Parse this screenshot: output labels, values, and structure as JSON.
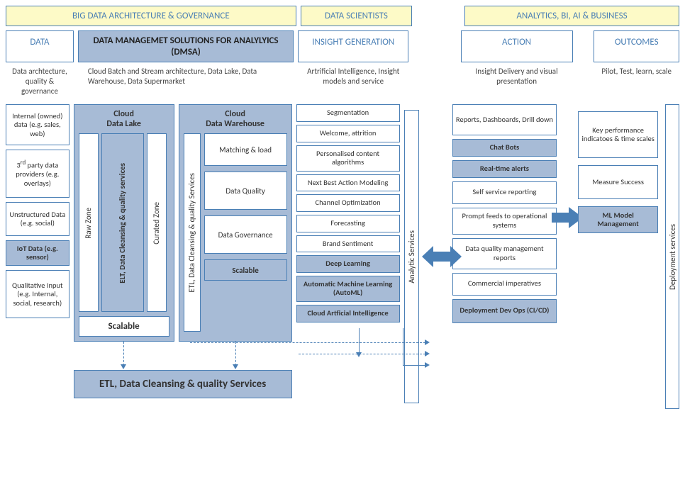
{
  "headers": {
    "h1": "BIG DATA ARCHITECTURE & GOVERNANCE",
    "h2": "DATA SCIENTISTS",
    "h3": "ANALYTICS, BI, AI & BUSINESS"
  },
  "stages": {
    "data": "DATA",
    "dmsa_l1": "DATA MANAGEMET SOLUTIONS FOR ANALYLYICS",
    "dmsa_l2": "(DMSA)",
    "insight": "INSIGHT GENERATION",
    "action": "ACTION",
    "outcomes": "OUTCOMES"
  },
  "subs": {
    "data": "Data archtecture, quality & governance",
    "dmsa": "Cloud Batch and Stream architecture, Data Lake, Data Warehouse, Data Supermarket",
    "insight": "Artrificial Intelligence, Insight models and service",
    "action": "Insight Delivery and visual presentation",
    "outcomes": "Pilot, Test, learn, scale"
  },
  "data_sources": {
    "s1": "Internal (owned) data (e.g. sales, web)",
    "s2_a": "3",
    "s2_b": "rd",
    "s2_c": " party data providers (e.g. overlays)",
    "s3": "Unstructured Data (e.g. social)",
    "s4": "IoT Data (e.g. sensor)",
    "s5": "Qualitative Input (e.g. Internal, social, research)"
  },
  "cloud_lake": {
    "title": "Cloud\nData Lake",
    "raw": "Raw Zone",
    "elt": "ELT, Data Cleansing & quality services",
    "curated": "Curated Zone",
    "scalable": "Scalable"
  },
  "cloud_dw": {
    "title": "Cloud\nData Warehouse",
    "etl": "ETL, Data Cleansing & quality Services",
    "b1": "Matching & load",
    "b2": "Data Quality",
    "b3": "Data Governance",
    "b4": "Scalable"
  },
  "etl_bar": "ETL, Data Cleansing & quality Services",
  "insight_items": {
    "i1": "Segmentation",
    "i2": "Welcome, attrition",
    "i3": "Personalised content algorithms",
    "i4": "Next Best Action Modeling",
    "i5": "Channel Optimization",
    "i6": "Forecasting",
    "i7": "Brand Sentiment",
    "i8": "Deep Learning",
    "i9": "Automatic Machine Learning (AutoML)",
    "i10": "Cloud Artficial Intelligence"
  },
  "analytic_services": "Analytic Services",
  "action_items": {
    "a1": "Reports, Dashboards, Drill down",
    "a2": "Chat Bots",
    "a3": "Real-time alerts",
    "a4": "Self service reporting",
    "a5": "Prompt feeds to operational systems",
    "a6": "Data quality management reports",
    "a7": "Commercial imperatives",
    "a8": "Deployment Dev Ops (CI/CD)"
  },
  "outcome_items": {
    "o1": "Key performance indicatoes & time scales",
    "o2": "Measure Success",
    "o3": "ML Model Management"
  },
  "deployment_services": "Deployment services"
}
